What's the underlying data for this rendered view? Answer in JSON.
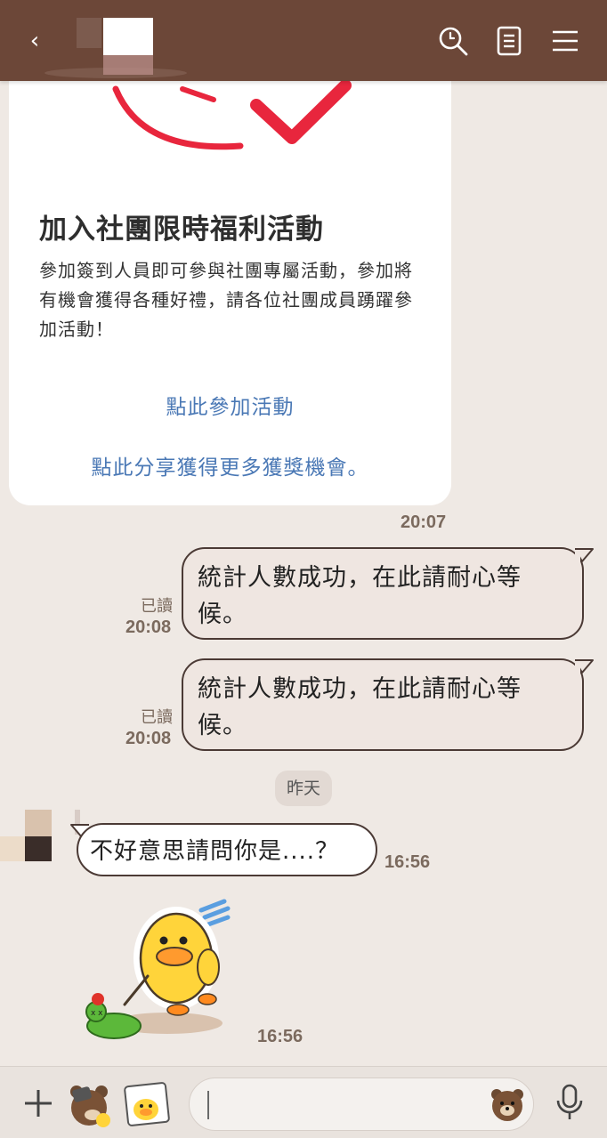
{
  "header": {
    "back_label": "‹",
    "icons": [
      "search-icon",
      "notes-icon",
      "menu-icon"
    ],
    "background": "#6c4738"
  },
  "card": {
    "title": "加入社團限時福利活動",
    "description": "參加簽到人員即可參與社團專屬活動，參加將有機會獲得各種好禮，請各位社團成員踴躍參加活動！",
    "link_join": "點此參加活動",
    "link_share": "點此分享獲得更多獲獎機會。",
    "time": "20:07",
    "accent": "#e8263d",
    "link_color": "#4a78b5"
  },
  "outgoing": [
    {
      "text": "統計人數成功，在此請耐心等候。",
      "read": "已讀",
      "time": "20:08"
    },
    {
      "text": "統計人數成功，在此請耐心等候。",
      "read": "已讀",
      "time": "20:08"
    }
  ],
  "date_chip": "昨天",
  "incoming": {
    "text": "不好意思請問你是....？",
    "time": "16:56"
  },
  "sticker": {
    "name": "duck-sticker",
    "time": "16:56"
  },
  "bottom_bar": {
    "icons": [
      "plus-icon",
      "bear-emoji-icon",
      "sticker-duck-icon",
      "bear-face-icon",
      "microphone-icon"
    ],
    "input_value": ""
  }
}
